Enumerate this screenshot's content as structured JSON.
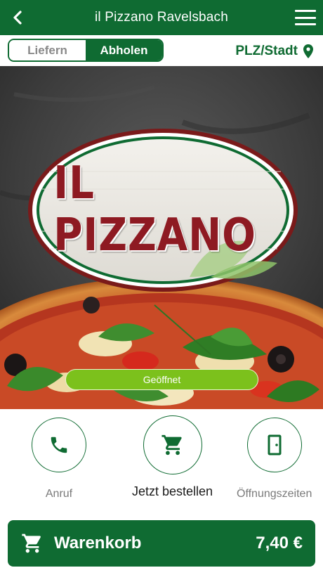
{
  "header": {
    "title": "il Pizzano Ravelsbach"
  },
  "mode_toggle": {
    "options": [
      "Liefern",
      "Abholen"
    ],
    "selected": "Abholen"
  },
  "location": {
    "label": "PLZ/Stadt"
  },
  "hero": {
    "logo_text": "IL PIZZANO",
    "status": "Geöffnet"
  },
  "actions": {
    "call": "Anruf",
    "order": "Jetzt bestellen",
    "hours": "Öffnungszeiten"
  },
  "cart": {
    "label": "Warenkorb",
    "total": "7,40 €"
  },
  "colors": {
    "brand_green": "#0f6b32",
    "status_green": "#7cc11c",
    "logo_red": "#8e1a22"
  }
}
